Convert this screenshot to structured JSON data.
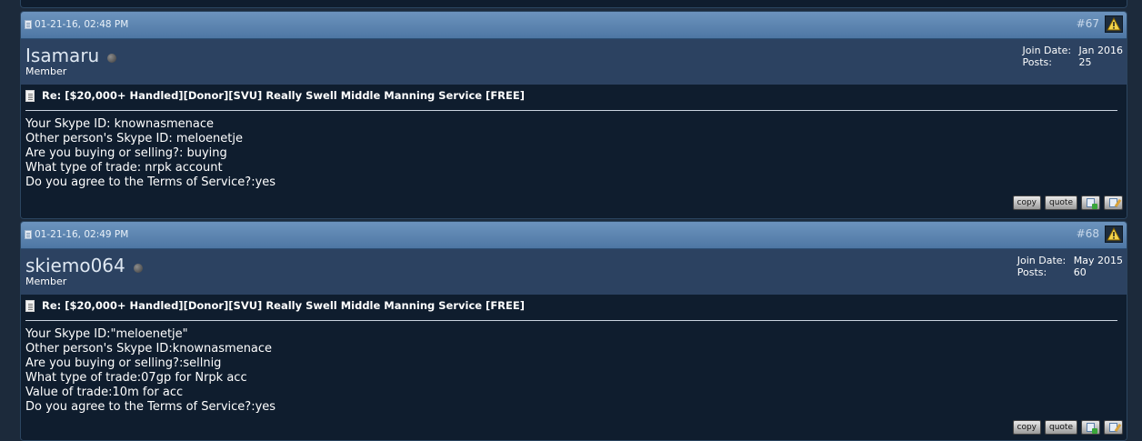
{
  "posts": [
    {
      "date": "01-21-16, 02:48 PM",
      "number": "#67",
      "username": "Isamaru",
      "usertitle": "Member",
      "join_date_label": "Join Date:",
      "join_date": "Jan 2016",
      "posts_label": "Posts:",
      "posts_count": "25",
      "title": "Re: [$20,000+ Handled][Donor][SVU] Really Swell Middle Manning Service [FREE]",
      "lines": [
        "Your Skype ID: knownasmenace",
        "Other person's Skype ID: meloenetje",
        "Are you buying or selling?: buying",
        "What type of trade: nrpk account",
        "Do you agree to the Terms of Service?:yes"
      ],
      "copy_label": "copy",
      "quote_label": "quote"
    },
    {
      "date": "01-21-16, 02:49 PM",
      "number": "#68",
      "username": "skiemo064",
      "usertitle": "Member",
      "join_date_label": "Join Date:",
      "join_date": "May 2015",
      "posts_label": "Posts:",
      "posts_count": "60",
      "title": "Re: [$20,000+ Handled][Donor][SVU] Really Swell Middle Manning Service [FREE]",
      "lines": [
        "Your Skype ID:\"meloenetje\"",
        "Other person's Skype ID:knownasmenace",
        "Are you buying or selling?:sellnig",
        "What type of trade:07gp for Nrpk acc",
        "Value of trade:10m for acc",
        "Do you agree to the Terms of Service?:yes"
      ],
      "copy_label": "copy",
      "quote_label": "quote"
    }
  ]
}
